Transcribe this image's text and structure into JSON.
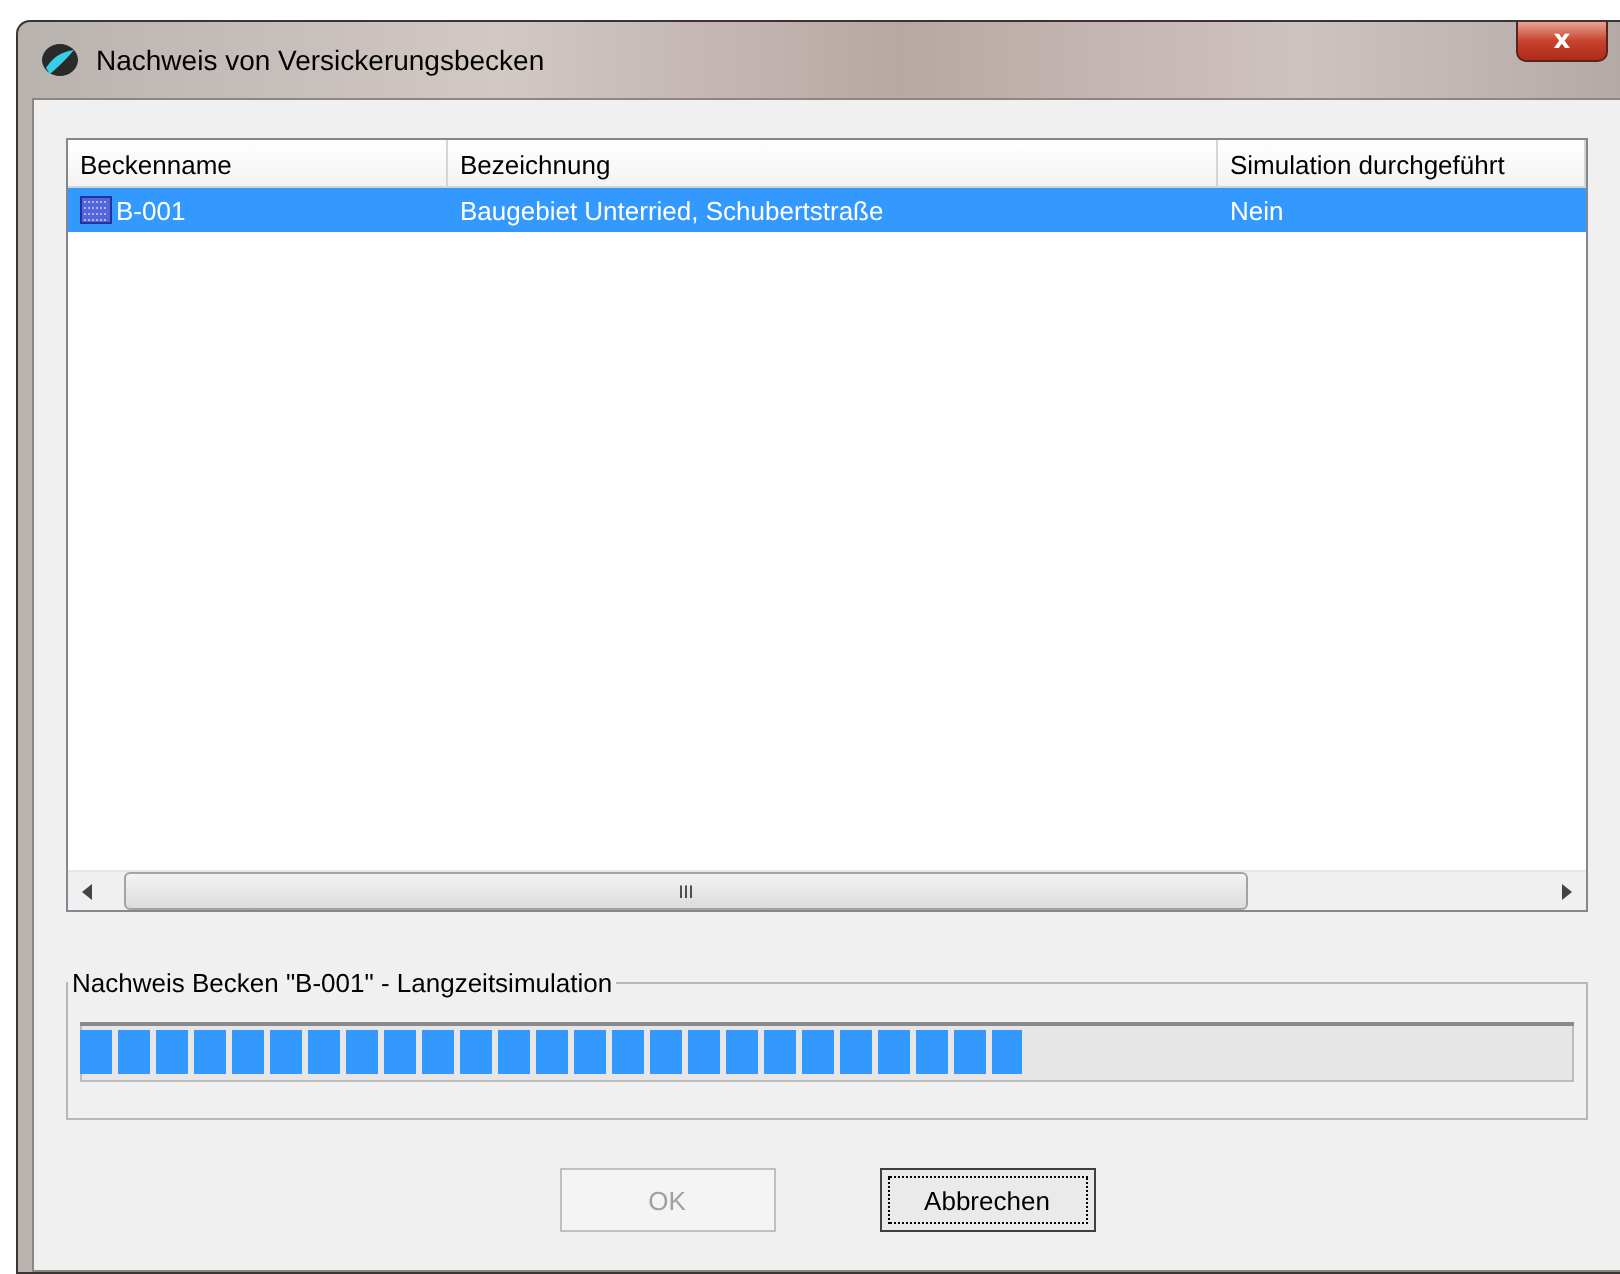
{
  "window": {
    "title": "Nachweis von Versickerungsbecken",
    "close_label": "x"
  },
  "list": {
    "columns": [
      "Beckenname",
      "Bezeichnung",
      "Simulation durchgeführt"
    ],
    "rows": [
      {
        "cells": [
          "B-001",
          "Baugebiet Unterried, Schubertstraße",
          "Nein"
        ],
        "selected": true
      }
    ],
    "scrollbar": {
      "grip": "III"
    }
  },
  "progress": {
    "title": "Nachweis Becken \"B-001\" - Langzeitsimulation",
    "level": 0.63
  },
  "buttons": [
    {
      "label": "OK",
      "disabled": true,
      "focused": false
    },
    {
      "label": "Abbrechen",
      "disabled": false,
      "focused": true
    }
  ]
}
